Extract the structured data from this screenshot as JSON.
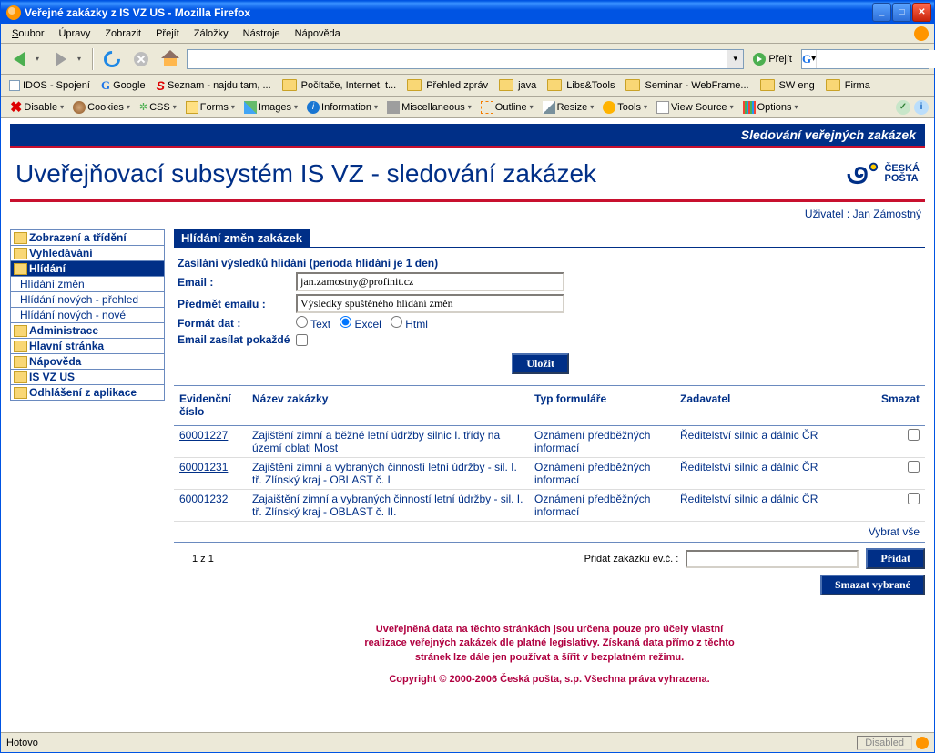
{
  "window": {
    "title": "Veřejné zakázky z IS VZ US - Mozilla Firefox"
  },
  "menubar": {
    "soubor": "Soubor",
    "upravy": "Úpravy",
    "zobrazit": "Zobrazit",
    "prejit": "Přejít",
    "zalozky": "Záložky",
    "nastroje": "Nástroje",
    "napoveda": "Nápověda"
  },
  "nav": {
    "url": "",
    "go": "Přejít",
    "search": ""
  },
  "bookmarks": {
    "idos": "IDOS - Spojení",
    "google": "Google",
    "seznam": "Seznam - najdu tam, ...",
    "pocitace": "Počítače, Internet, t...",
    "prehled": "Přehled zpráv",
    "java": "java",
    "libs": "Libs&Tools",
    "seminar": "Seminar - WebFrame...",
    "sweng": "SW eng",
    "firma": "Firma"
  },
  "devtools": {
    "disable": "Disable",
    "cookies": "Cookies",
    "css": "CSS",
    "forms": "Forms",
    "images": "Images",
    "information": "Information",
    "misc": "Miscellaneous",
    "outline": "Outline",
    "resize": "Resize",
    "tools": "Tools",
    "viewsource": "View Source",
    "options": "Options"
  },
  "app": {
    "top_banner": "Sledování veřejných zakázek",
    "title": "Uveřejňovací subsystém IS VZ - sledování zakázek",
    "logo_line1": "ČESKÁ",
    "logo_line2": "POŠTA",
    "user_label": "Uživatel :",
    "user_name": "Jan Zámostný"
  },
  "sidebar": {
    "zobrazeni": "Zobrazení a třídění",
    "vyhledavani": "Vyhledávání",
    "hlidani": "Hlídání",
    "hlidani_zmen": "Hlídání změn",
    "hlidani_prehled": "Hlídání nových - přehled",
    "hlidani_nove": "Hlídání nových - nové",
    "administrace": "Administrace",
    "hlavni": "Hlavní stránka",
    "napoveda": "Nápověda",
    "isvz": "IS VZ US",
    "odhlaseni": "Odhlášení z aplikace"
  },
  "form": {
    "section_title": "Hlídání změn zakázek",
    "period": "Zasílání výsledků hlídání (perioda hlídání je 1 den)",
    "email_label": "Email :",
    "email_value": "jan.zamostny@profinit.cz",
    "subject_label": "Předmět emailu :",
    "subject_value": "Výsledky spuštěného hlídání změn",
    "format_label": "Formát dat :",
    "fmt_text": "Text",
    "fmt_excel": "Excel",
    "fmt_html": "Html",
    "always_label": "Email zasílat pokaždé",
    "save_btn": "Uložit"
  },
  "table": {
    "h_evidence": "Evidenční číslo",
    "h_name": "Název zakázky",
    "h_type": "Typ formuláře",
    "h_client": "Zadavatel",
    "h_delete": "Smazat",
    "rows": [
      {
        "id": "60001227",
        "name": "Zajištění zimní a běžné letní údržby silnic I. třídy na území oblati Most",
        "type": "Oznámení předběžných informací",
        "client": "Ředitelství silnic a dálnic ČR"
      },
      {
        "id": "60001231",
        "name": "Zajištění zimní a vybraných činností letní údržby - sil. I. tř. Zlínský kraj - OBLAST č. I",
        "type": "Oznámení předběžných informací",
        "client": "Ředitelství silnic a dálnic ČR"
      },
      {
        "id": "60001232",
        "name": "Zajaištění zimní a vybraných činností letní údržby - sil. I. tř. Zlínský kraj - OBLAST č. II.",
        "type": "Oznámení předběžných informací",
        "client": "Ředitelství silnic a dálnic ČR"
      }
    ],
    "select_all": "Vybrat vše",
    "pager": "1 z 1",
    "add_label": "Přidat zakázku ev.č. :",
    "add_value": "",
    "add_btn": "Přidat",
    "delete_btn": "Smazat vybrané"
  },
  "footer": {
    "disclaimer1": "Uveřejněná data na těchto stránkách jsou určena pouze pro účely vlastní",
    "disclaimer2": "realizace veřejných zakázek dle platné legislativy. Získaná data přímo z těchto",
    "disclaimer3": "stránek lze dále jen používat a šířit v bezplatném režimu.",
    "copyright": "Copyright © 2000-2006 Česká pošta, s.p. Všechna práva vyhrazena."
  },
  "status": {
    "text": "Hotovo",
    "disabled": "Disabled"
  }
}
